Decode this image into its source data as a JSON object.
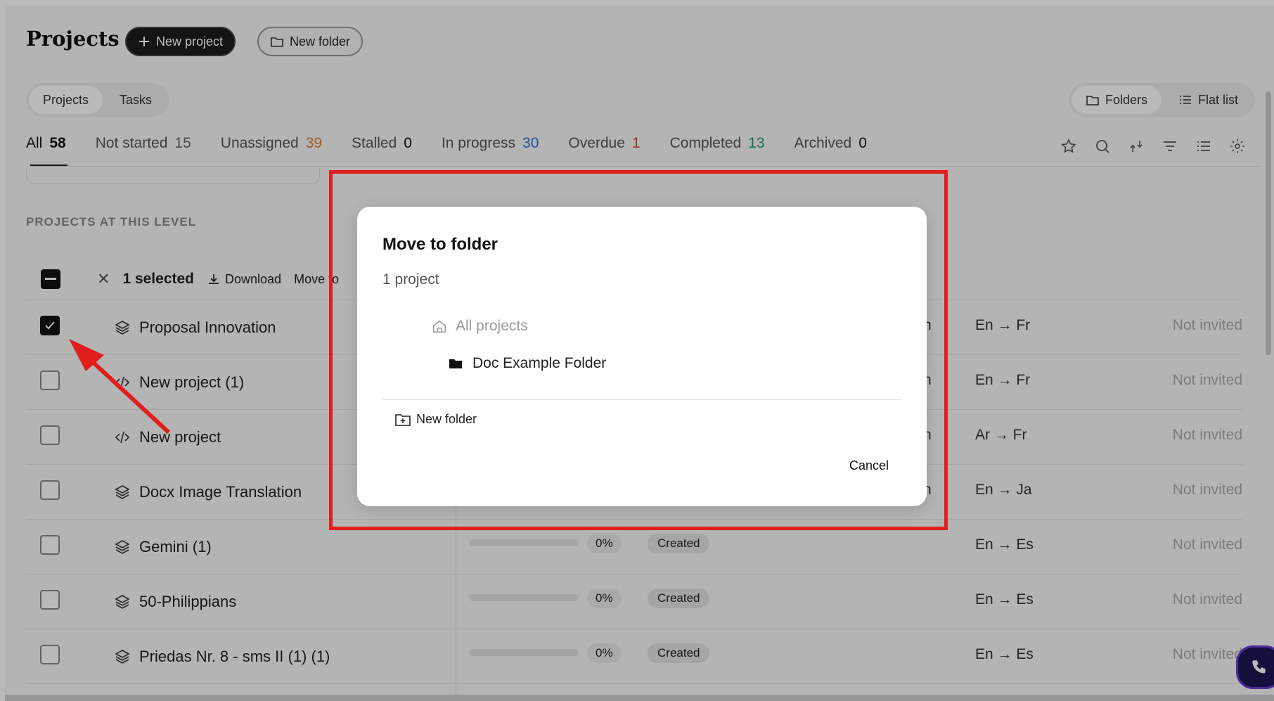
{
  "header": {
    "title": "Projects",
    "new_project_label": "New project",
    "new_folder_label": "New folder"
  },
  "view_toggle": {
    "left": [
      {
        "label": "Projects",
        "active": true
      },
      {
        "label": "Tasks",
        "active": false
      }
    ],
    "right": [
      {
        "label": "Folders",
        "active": true
      },
      {
        "label": "Flat list",
        "active": false
      }
    ]
  },
  "status_tabs": [
    {
      "label": "All",
      "count": "58",
      "count_color": "#111111",
      "active": true
    },
    {
      "label": "Not started",
      "count": "15",
      "count_color": "#666666"
    },
    {
      "label": "Unassigned",
      "count": "39",
      "count_color": "#d9822b"
    },
    {
      "label": "Stalled",
      "count": "0",
      "count_color": "#111111"
    },
    {
      "label": "In progress",
      "count": "30",
      "count_color": "#2f6fd6"
    },
    {
      "label": "Overdue",
      "count": "1",
      "count_color": "#d63b3b"
    },
    {
      "label": "Completed",
      "count": "13",
      "count_color": "#1f9a6c"
    },
    {
      "label": "Archived",
      "count": "0",
      "count_color": "#111111"
    }
  ],
  "toolbar_icons": [
    "star-icon",
    "search-icon",
    "collapse-icon",
    "filter-icon",
    "list-icon",
    "settings-icon"
  ],
  "section_label": "PROJECTS AT THIS LEVEL",
  "bulkbar": {
    "selected_label": "1 selected",
    "download_label": "Download",
    "move_label": "Move to"
  },
  "rows": [
    {
      "name": "Proposal Innovation",
      "icon": "layers-icon",
      "checked": true,
      "lang": "En → Fr",
      "invite": "Not invited",
      "clip": "n"
    },
    {
      "name": "New project (1)",
      "icon": "code-icon",
      "checked": false,
      "lang": "En → Fr",
      "invite": "Not invited",
      "clip": "n"
    },
    {
      "name": "New project",
      "icon": "code-icon",
      "checked": false,
      "lang": "Ar → Fr",
      "invite": "Not invited",
      "clip": "n"
    },
    {
      "name": "Docx Image Translation",
      "icon": "layers-icon",
      "checked": false,
      "lang": "En → Ja",
      "invite": "Not invited",
      "clip": "n"
    },
    {
      "name": "Gemini (1)",
      "icon": "layers-icon",
      "checked": false,
      "lang": "En → Es",
      "invite": "Not invited",
      "progress": "0%",
      "status": "Created"
    },
    {
      "name": "50-Philippians",
      "icon": "layers-icon",
      "checked": false,
      "lang": "En → Es",
      "invite": "Not invited",
      "progress": "0%",
      "status": "Created"
    },
    {
      "name": "Priedas Nr. 8 - sms II (1) (1)",
      "icon": "layers-icon",
      "checked": false,
      "lang": "En → Es",
      "invite": "Not invited",
      "progress": "0%",
      "status": "Created"
    }
  ],
  "dialog": {
    "title": "Move to folder",
    "subtitle": "1 project",
    "root_label": "All projects",
    "folder_label": "Doc Example Folder",
    "new_folder_label": "New folder",
    "cancel_label": "Cancel"
  },
  "annotation_color": "#e11d1d"
}
